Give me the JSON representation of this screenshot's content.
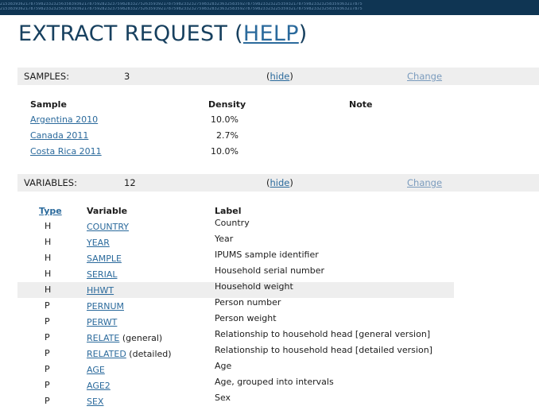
{
  "header": {
    "band_digits": "2153839362178759823323256358393621787592823237598283327526359392178759823323275983283236325835927875982332322535932178759823323258359363217875",
    "title_prefix": "EXTRACT REQUEST (",
    "help_link": "HELP",
    "title_suffix": ")"
  },
  "samples_section": {
    "label": "SAMPLES:",
    "count": "3",
    "hide_open": "(",
    "hide_link": "hide",
    "hide_close": ")",
    "change_link": "Change",
    "columns": {
      "sample": "Sample",
      "density": "Density",
      "note": "Note"
    },
    "rows": [
      {
        "name": "Argentina 2010",
        "density": "10.0%"
      },
      {
        "name": "Canada 2011",
        "density": "2.7%"
      },
      {
        "name": "Costa Rica 2011",
        "density": "10.0%"
      }
    ]
  },
  "variables_section": {
    "label": "VARIABLES:",
    "count": "12",
    "hide_open": "(",
    "hide_link": "hide",
    "hide_close": ")",
    "change_link": "Change",
    "columns": {
      "type": "Type",
      "variable": "Variable",
      "label": "Label"
    },
    "rows": [
      {
        "type": "H",
        "name": "COUNTRY",
        "suffix": "",
        "label": "Country"
      },
      {
        "type": "H",
        "name": "YEAR",
        "suffix": "",
        "label": "Year"
      },
      {
        "type": "H",
        "name": "SAMPLE",
        "suffix": "",
        "label": "IPUMS sample identifier"
      },
      {
        "type": "H",
        "name": "SERIAL",
        "suffix": "",
        "label": "Household serial number"
      },
      {
        "type": "H",
        "name": "HHWT",
        "suffix": "",
        "label": "Household weight"
      },
      {
        "type": "P",
        "name": "PERNUM",
        "suffix": "",
        "label": "Person number"
      },
      {
        "type": "P",
        "name": "PERWT",
        "suffix": "",
        "label": "Person weight"
      },
      {
        "type": "P",
        "name": "RELATE",
        "suffix": " (general)",
        "label": "Relationship to household head [general version]"
      },
      {
        "type": "P",
        "name": "RELATED",
        "suffix": " (detailed)",
        "label": "Relationship to household head [detailed version]"
      },
      {
        "type": "P",
        "name": "AGE",
        "suffix": "",
        "label": "Age"
      },
      {
        "type": "P",
        "name": "AGE2",
        "suffix": "",
        "label": "Age, grouped into intervals"
      },
      {
        "type": "P",
        "name": "SEX",
        "suffix": "",
        "label": "Sex"
      }
    ]
  },
  "colors": {
    "band": "#0f3553",
    "title": "#17405f",
    "link": "#2b6a9c",
    "change_link": "#7a9bbd",
    "section_bar": "#eeeeee"
  }
}
